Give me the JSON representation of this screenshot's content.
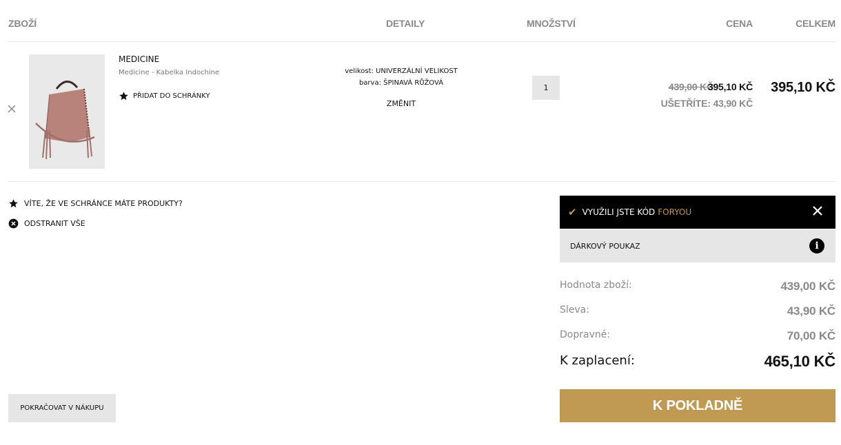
{
  "table_headers": {
    "item": "ZBOŽÍ",
    "details": "DETAILY",
    "quantity": "MNOŽSTVÍ",
    "price": "CENA",
    "total": "CELKEM"
  },
  "item": {
    "name": "MEDICINE",
    "subtitle": "Medicine - Kabelka Indochine",
    "add_to_box": "PŘIDAT DO SCHRÁNKY",
    "size_line": "velikost: UNIVERZÁLNÍ VELIKOST",
    "color_line": "barva: ŠPINAVÁ RŮŽOVÁ",
    "change_label": "ZMĚNIT",
    "quantity": "1",
    "price_old": "439,00 KČ",
    "price_new": "395,10 KČ",
    "savings": "UŠETŘÍTE: 43,90 KČ",
    "line_total": "395,10 KČ",
    "remove_icon": "close-icon"
  },
  "links": {
    "box_notice": "VÍTE, ŽE VE SCHRÁNCE MÁTE PRODUKTY?",
    "remove_all": "ODSTRANIT VŠE"
  },
  "coupon": {
    "text": "VYUŽILI JSTE KÓD",
    "code": "FORYOU"
  },
  "voucher": {
    "label": "DÁRKOVÝ POUKAZ"
  },
  "summary": {
    "goods_label": "Hodnota zboží:",
    "goods_value": "439,00 KČ",
    "discount_label": "Sleva:",
    "discount_value": "43,90 KČ",
    "shipping_label": "Dopravné:",
    "shipping_value": "70,00 KČ",
    "total_label": "K zaplacení:",
    "total_value": "465,10 KČ"
  },
  "buttons": {
    "checkout": "K POKLADNĚ",
    "continue": "POKRAČOVAT V NÁKUPU"
  },
  "colors": {
    "accent": "#c09a52",
    "muted_text": "#8a8a8a",
    "panel_gray": "#e6e6e6",
    "bag": "#b8837b"
  }
}
